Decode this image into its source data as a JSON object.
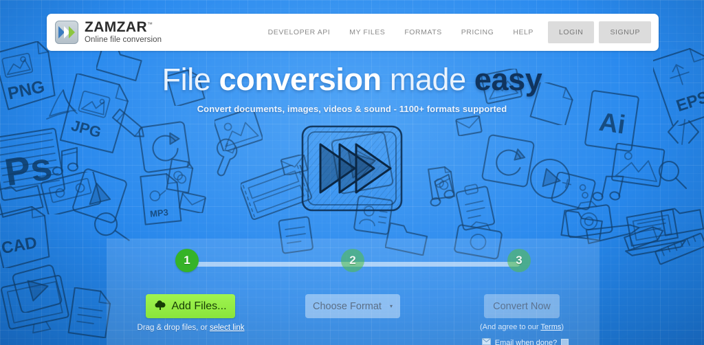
{
  "header": {
    "logo_icon": "zamzar-chevrons-logo-icon",
    "brand_title": "ZAMZAR",
    "brand_tm": "™",
    "brand_subtitle": "Online file conversion",
    "nav_links": [
      {
        "label": "DEVELOPER API",
        "name": "nav-developer-api"
      },
      {
        "label": "MY FILES",
        "name": "nav-my-files"
      },
      {
        "label": "FORMATS",
        "name": "nav-formats"
      },
      {
        "label": "PRICING",
        "name": "nav-pricing"
      },
      {
        "label": "HELP",
        "name": "nav-help"
      }
    ],
    "login_label": "LOGIN",
    "signup_label": "SIGNUP"
  },
  "hero": {
    "headline_word1": "File",
    "headline_word2": "conversion",
    "headline_word3": "made",
    "headline_word4": "easy",
    "subheadline": "Convert documents, images, videos & sound - 1100+ formats supported",
    "center_icon": "fast-forward-sketch-icon"
  },
  "converter": {
    "steps": [
      {
        "number": "1",
        "state": "active"
      },
      {
        "number": "2",
        "state": "idle"
      },
      {
        "number": "3",
        "state": "idle"
      }
    ],
    "add_files_label": "Add Files...",
    "add_files_icon": "cloud-upload-icon",
    "dropzone_prefix": "Drag & drop files, or ",
    "dropzone_link": "select link",
    "choose_format_label": "Choose Format",
    "choose_format_caret": "▾",
    "convert_label": "Convert Now",
    "terms_prefix": "(And agree to our ",
    "terms_link": "Terms",
    "terms_suffix": ")",
    "email_icon": "envelope-icon",
    "email_label": "Email when done?",
    "email_checked": false
  },
  "colors": {
    "background_blue": "#2a8aee",
    "background_blue_dark": "#1668c6",
    "sketch_ink": "#10406f",
    "accent_green": "#35b327",
    "add_button_green": "#8ae53c",
    "header_white": "#ffffff",
    "nav_text_gray": "#8a8a8a",
    "nav_button_gray": "#dcdcdc",
    "headline_dark_blue": "#10345e"
  },
  "background_doodles": [
    "png-file-icon",
    "jpg-file-icon",
    "ps-file-icon",
    "cad-file-icon",
    "pdf-acrobat-icon",
    "eps-file-icon",
    "ai-file-icon",
    "mp3-file-icon",
    "music-note-icon",
    "envelope-icon",
    "wrench-icon",
    "refresh-icon",
    "play-icon",
    "pencil-icon",
    "ruler-icon",
    "laptop-icon",
    "folder-icon",
    "clipboard-icon",
    "camera-icon",
    "film-icon",
    "image-icon",
    "code-brackets-icon",
    "search-icon",
    "contact-card-icon",
    "cassette-tape-icon",
    "monitor-icon",
    "document-icon"
  ]
}
